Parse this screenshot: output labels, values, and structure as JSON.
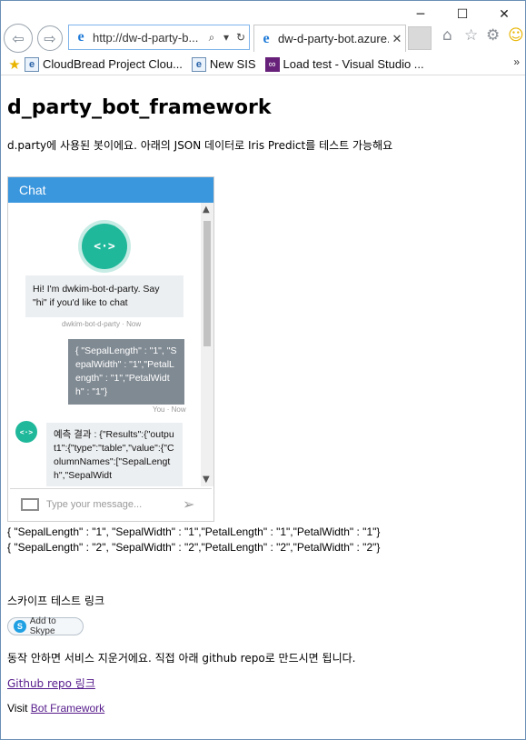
{
  "browser": {
    "address": "http://dw-d-party-b...",
    "tab_title": "dw-d-party-bot.azure...",
    "favorites": [
      {
        "label": "CloudBread Project Clou..."
      },
      {
        "label": "New SIS"
      },
      {
        "label": "Load test - Visual Studio ..."
      }
    ]
  },
  "page": {
    "title": "d_party_bot_framework",
    "intro": "d.party에 사용된 봇이에요. 아래의 JSON 데이터로 Iris Predict를 테스트 가능해요",
    "chat": {
      "header": "Chat",
      "bot_message": "Hi! I'm dwkim-bot-d-party. Say \"hi\" if you'd like to chat",
      "bot_meta": "dwkim-bot-d-party · Now",
      "user_message": "{ \"SepalLength\" : \"1\", \"SepalWidth\" : \"1\",\"PetalLength\" : \"1\",\"PetalWidth\" : \"1\"}",
      "user_meta": "You · Now",
      "bot_reply": "예측 결과 : {\"Results\":{\"output1\":{\"type\":\"table\",\"value\":{\"ColumnNames\":[\"SepalLength\",\"SepalWidt",
      "input_placeholder": "Type your message..."
    },
    "samples": [
      "{ \"SepalLength\" : \"1\", \"SepalWidth\" : \"1\",\"PetalLength\" : \"1\",\"PetalWidth\" : \"1\"}",
      "{ \"SepalLength\" : \"2\", \"SepalWidth\" : \"2\",\"PetalLength\" : \"2\",\"PetalWidth\" : \"2\"}"
    ],
    "skype_label": "스카이프 테스트 링크",
    "skype_button": "Add to Skype",
    "note": "동작 안하면 서비스 지운거에요. 직접 아래 github repo로 만드시면 됩니다.",
    "github_link": "Github repo 링크",
    "visit_prefix": "Visit ",
    "visit_link": "Bot Framework"
  }
}
